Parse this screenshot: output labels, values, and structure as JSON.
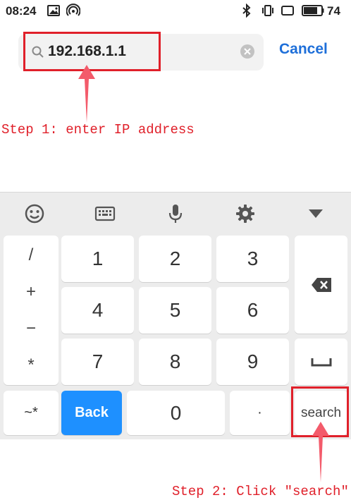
{
  "status_bar": {
    "time": "08:24",
    "battery": "74",
    "left_icons": [
      "image-icon",
      "hotspot-icon"
    ],
    "right_icons": [
      "bluetooth-icon",
      "vibrate-icon",
      "screen-icon",
      "battery-icon"
    ]
  },
  "search": {
    "value": "192.168.1.1",
    "cancel_label": "Cancel"
  },
  "annotations": {
    "step1": "Step 1: enter IP address",
    "step2": "Step 2: Click \"search\""
  },
  "keyboard": {
    "toolbar": [
      "emoji-icon",
      "keyboard-icon",
      "microphone-icon",
      "settings-icon",
      "collapse-icon"
    ],
    "side_keys": [
      "/",
      "+",
      "−",
      "*"
    ],
    "digits": [
      "1",
      "2",
      "3",
      "4",
      "5",
      "6",
      "7",
      "8",
      "9",
      "0"
    ],
    "symbols_label": "~*",
    "back_label": "Back",
    "dot_label": "·",
    "search_label": "search",
    "backspace_icon": "backspace-icon",
    "space_icon": "space-icon"
  },
  "colors": {
    "accent": "#1e6fd9",
    "back_key": "#1e90ff",
    "annotation": "#e0202a",
    "keyboard_bg": "#ececec"
  }
}
